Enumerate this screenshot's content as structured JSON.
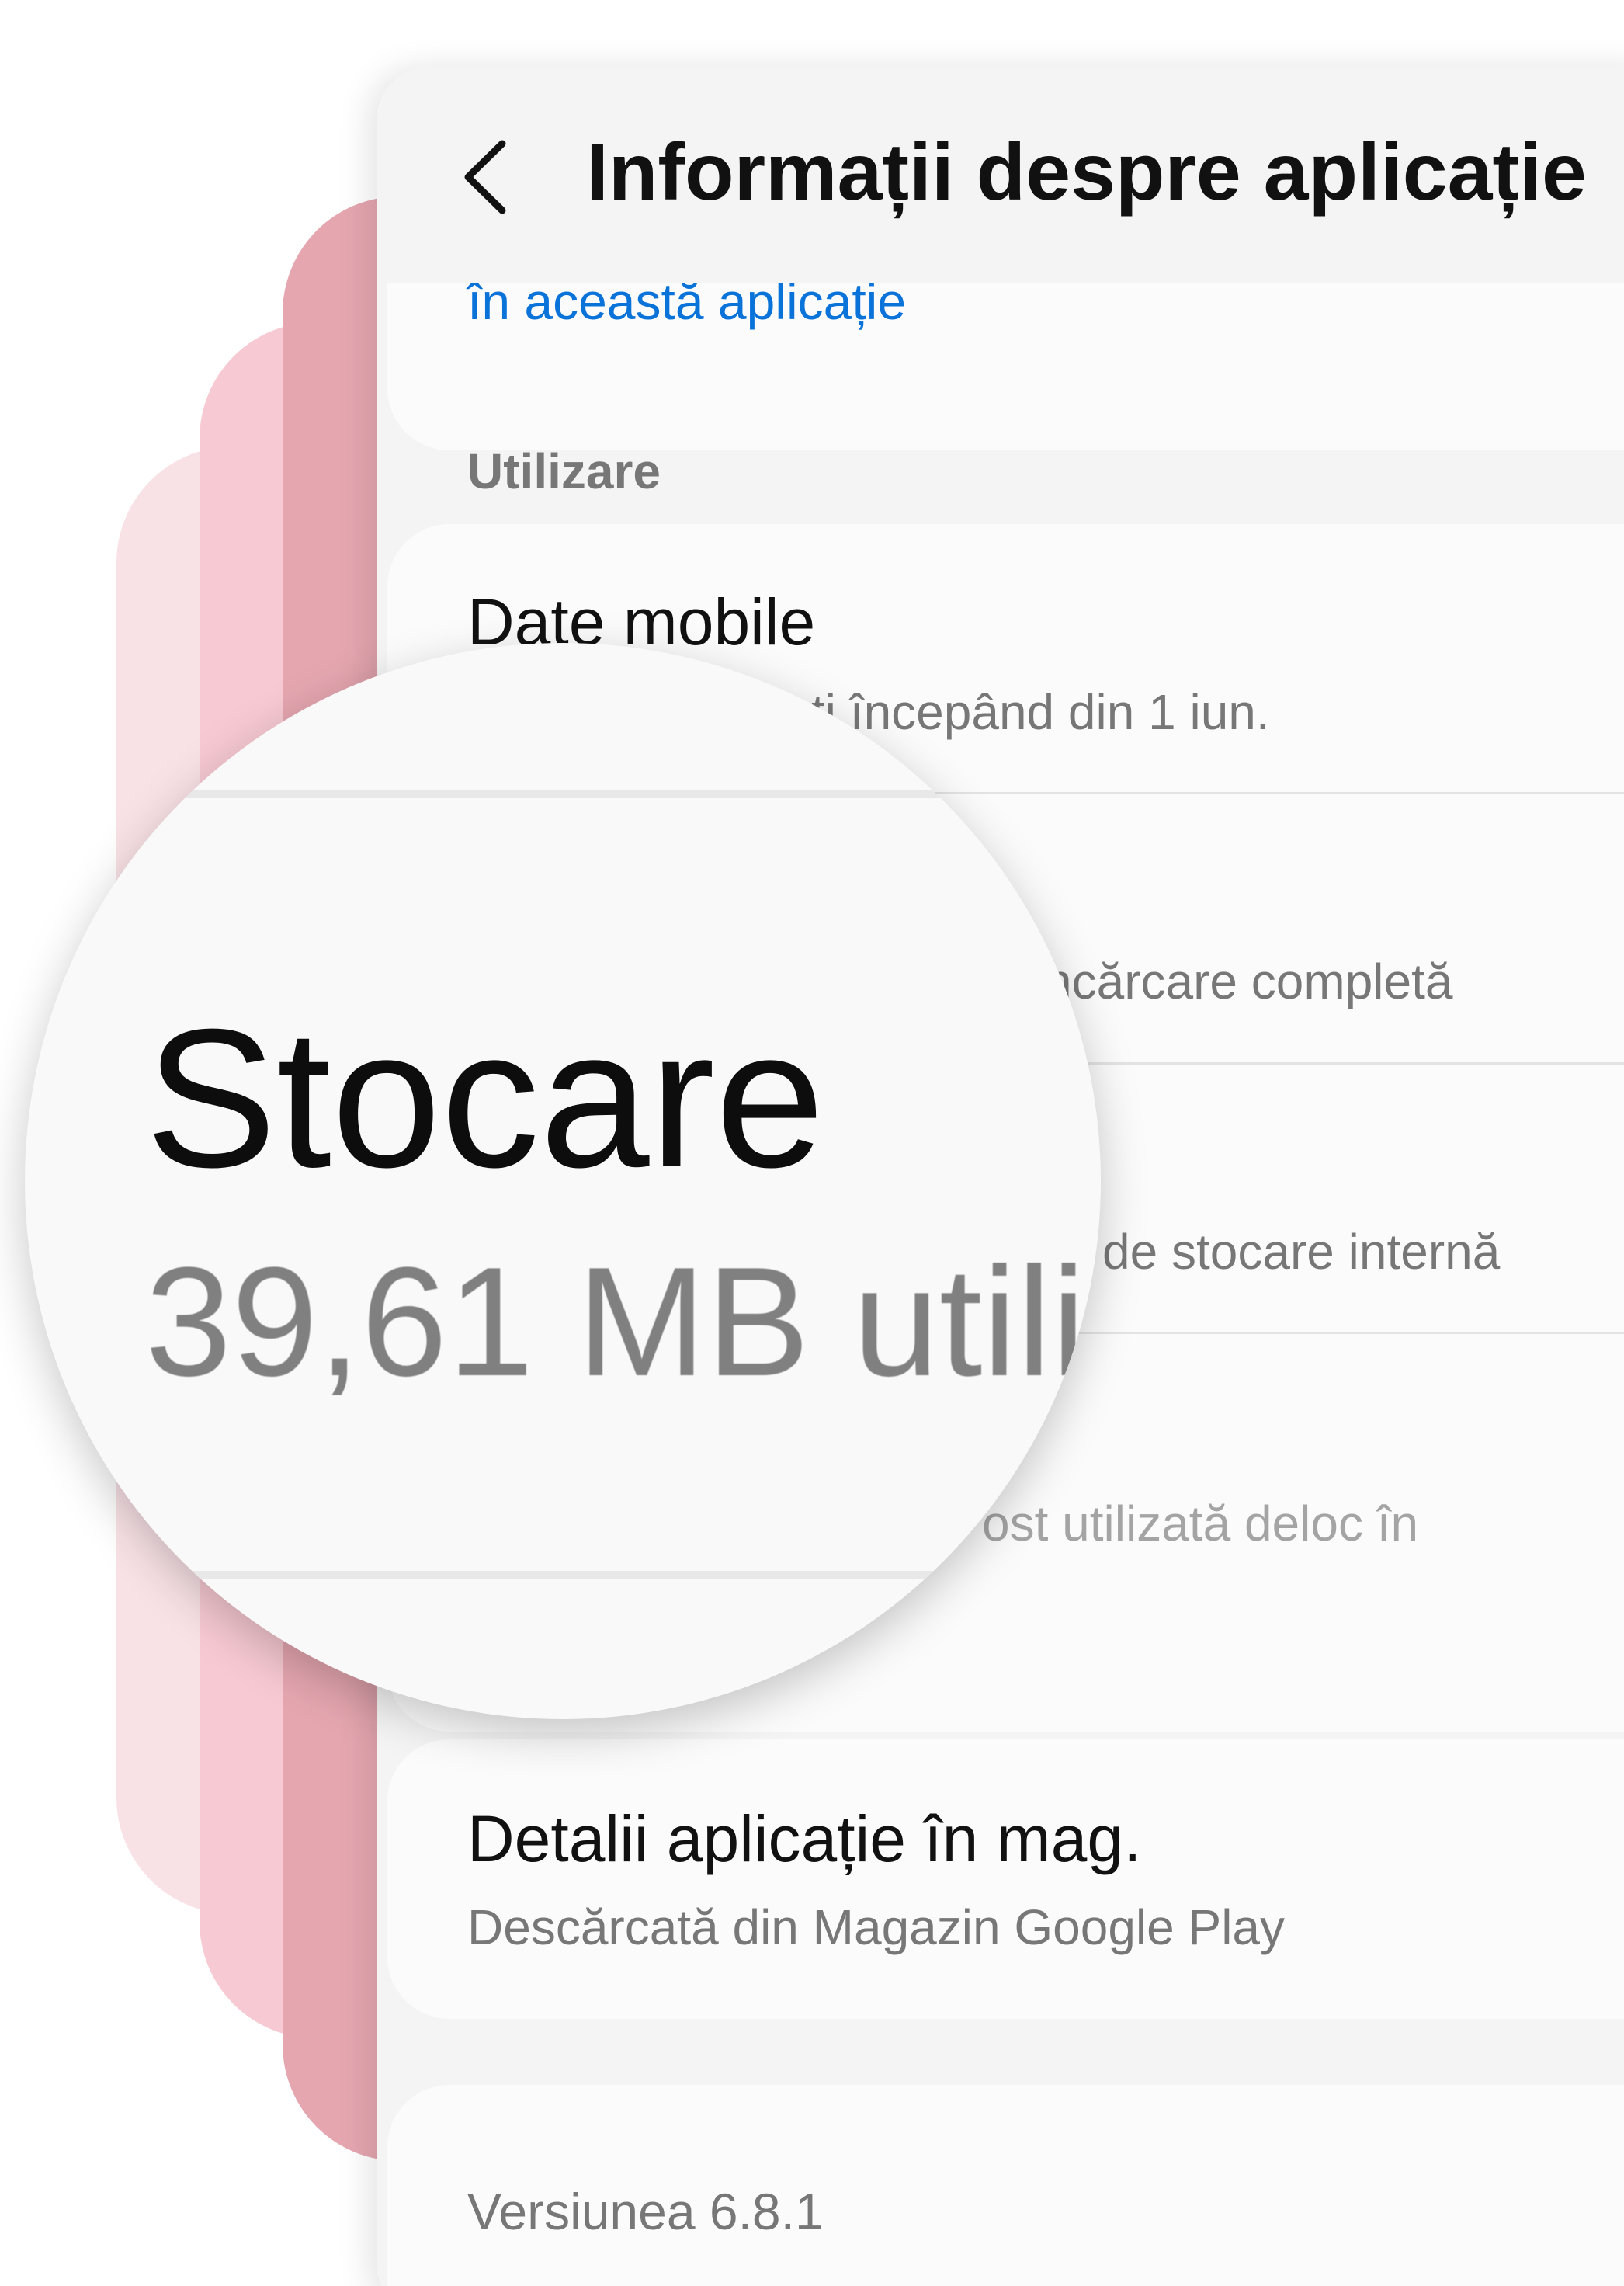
{
  "header": {
    "title": "Informații despre aplicație"
  },
  "top_card": {
    "link": "în această aplicație"
  },
  "usage": {
    "section_label": "Utilizare",
    "mobile_data": {
      "title": "Date mobile",
      "subtitle_visible": "ți începând din 1 iun."
    },
    "battery": {
      "subtitle_visible": "ncărcare completă"
    },
    "storage": {
      "subtitle_visible": "de stocare internă"
    },
    "unused": {
      "subtitle_visible": "ost utilizată deloc în"
    }
  },
  "store": {
    "title": "Detalii aplicație în mag.",
    "subtitle": "Descărcată din Magazin Google Play"
  },
  "version": {
    "text": "Versiunea 6.8.1"
  },
  "magnifier": {
    "title": "Stocare",
    "subtitle": "39,61 MB utili"
  },
  "icons": {
    "back": "chevron-left-icon"
  },
  "colors": {
    "link": "#0a73d9",
    "pink_light": "#f9e2e6",
    "pink_mid": "#f7c9d2",
    "pink_dark": "#e5a6b0"
  }
}
